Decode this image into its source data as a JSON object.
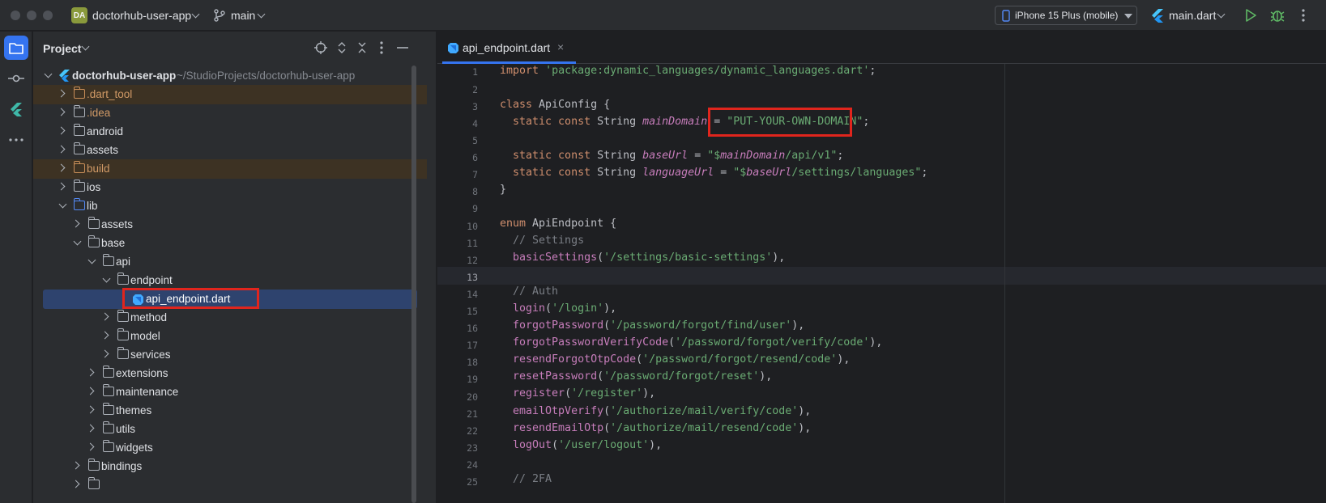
{
  "titlebar": {
    "project_badge": "DA",
    "project_name": "doctorhub-user-app",
    "branch": "main",
    "device": "iPhone 15 Plus (mobile)",
    "run_config": "main.dart"
  },
  "project_panel": {
    "title": "Project",
    "tree": [
      {
        "label": "doctorhub-user-app",
        "path": "~/StudioProjects/doctorhub-user-app"
      },
      {
        "label": ".dart_tool"
      },
      {
        "label": ".idea"
      },
      {
        "label": "android"
      },
      {
        "label": "assets"
      },
      {
        "label": "build"
      },
      {
        "label": "ios"
      },
      {
        "label": "lib"
      },
      {
        "label": "assets"
      },
      {
        "label": "base"
      },
      {
        "label": "api"
      },
      {
        "label": "endpoint"
      },
      {
        "label": "api_endpoint.dart"
      },
      {
        "label": "method"
      },
      {
        "label": "model"
      },
      {
        "label": "services"
      },
      {
        "label": "extensions"
      },
      {
        "label": "maintenance"
      },
      {
        "label": "themes"
      },
      {
        "label": "utils"
      },
      {
        "label": "widgets"
      },
      {
        "label": "bindings"
      }
    ]
  },
  "editor": {
    "tab_label": "api_endpoint.dart",
    "tab_close": "×",
    "line_numbers": [
      "1",
      "2",
      "3",
      "4",
      "5",
      "6",
      "7",
      "8",
      "9",
      "10",
      "11",
      "12",
      "13",
      "14",
      "15",
      "16",
      "17",
      "18",
      "19",
      "20",
      "21",
      "22",
      "23",
      "24",
      "25"
    ],
    "code": {
      "l1_kw": "import",
      "l1_str": "'package:dynamic_languages/dynamic_languages.dart'",
      "l1_end": ";",
      "l3_kw": "class",
      "l3_rest": " ApiConfig {",
      "l4_kw": "static const",
      "l4_type": " String ",
      "l4_fld": "mainDomain",
      "l4_eq": " = ",
      "l4_str": "\"PUT-YOUR-OWN-DOMAIN\"",
      "l4_end": ";",
      "l6_kw": "static const",
      "l6_type": " String ",
      "l6_fld": "baseUrl",
      "l6_eq": " = ",
      "l6_s1": "\"$",
      "l6_var": "mainDomain",
      "l6_s2": "/api/v1\"",
      "l6_end": ";",
      "l7_kw": "static const",
      "l7_type": " String ",
      "l7_fld": "languageUrl",
      "l7_eq": " = ",
      "l7_s1": "\"$",
      "l7_var": "baseUrl",
      "l7_s2": "/settings/languages\"",
      "l7_end": ";",
      "l8": "}",
      "l10_kw": "enum",
      "l10_rest": " ApiEndpoint {",
      "l11": "// Settings",
      "l12_fn": "basicSettings",
      "l12_s": "'/settings/basic-settings'",
      "l14": "// Auth",
      "l15_fn": "login",
      "l15_s": "'/login'",
      "l16_fn": "forgotPassword",
      "l16_s": "'/password/forgot/find/user'",
      "l17_fn": "forgotPasswordVerifyCode",
      "l17_s": "'/password/forgot/verify/code'",
      "l18_fn": "resendForgotOtpCode",
      "l18_s": "'/password/forgot/resend/code'",
      "l19_fn": "resetPassword",
      "l19_s": "'/password/forgot/reset'",
      "l20_fn": "register",
      "l20_s": "'/register'",
      "l21_fn": "emailOtpVerify",
      "l21_s": "'/authorize/mail/verify/code'",
      "l22_fn": "resendEmailOtp",
      "l22_s": "'/authorize/mail/resend/code'",
      "l23_fn": "logOut",
      "l23_s": "'/user/logout'",
      "l25": "// 2FA",
      "open_paren": "(",
      "close_paren": "),"
    }
  },
  "colors": {
    "accent": "#3574f0",
    "highlight_box": "#e0251d"
  }
}
